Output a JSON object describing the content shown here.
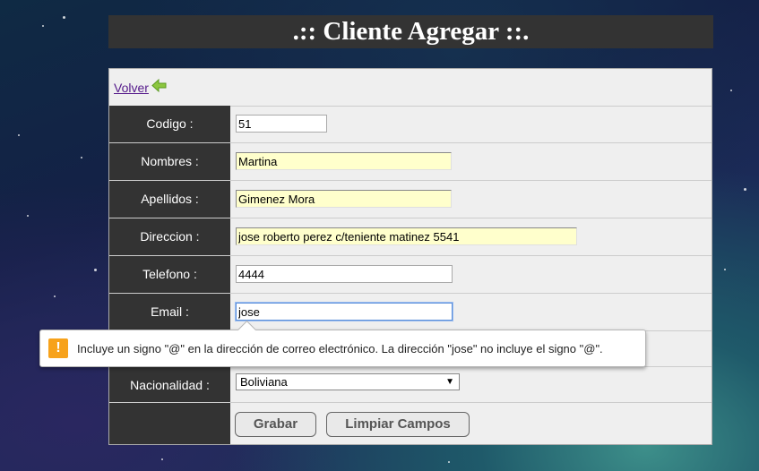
{
  "page": {
    "title": ".:: Cliente Agregar ::."
  },
  "nav": {
    "back_label": "Volver"
  },
  "form": {
    "fields": [
      {
        "label": "Codigo :",
        "value": "51"
      },
      {
        "label": "Nombres :",
        "value": "Martina"
      },
      {
        "label": "Apellidos :",
        "value": "Gimenez Mora"
      },
      {
        "label": "Direccion :",
        "value": "jose roberto perez c/teniente matinez 5541"
      },
      {
        "label": "Telefono :",
        "value": "4444"
      },
      {
        "label": "Email :",
        "value": "jose"
      }
    ],
    "nacionalidad": {
      "label": "Nacionalidad :",
      "selected": "Boliviana"
    },
    "buttons": {
      "save": "Grabar",
      "clear": "Limpiar Campos"
    }
  },
  "validation": {
    "message": "Incluye un signo \"@\" en la dirección de correo electrónico. La dirección \"jose\" no incluye el signo \"@\".",
    "icon": "warning-icon",
    "icon_color": "#f7a21b"
  },
  "colors": {
    "label_bg": "#333333",
    "highlight_input": "#ffffcc"
  }
}
